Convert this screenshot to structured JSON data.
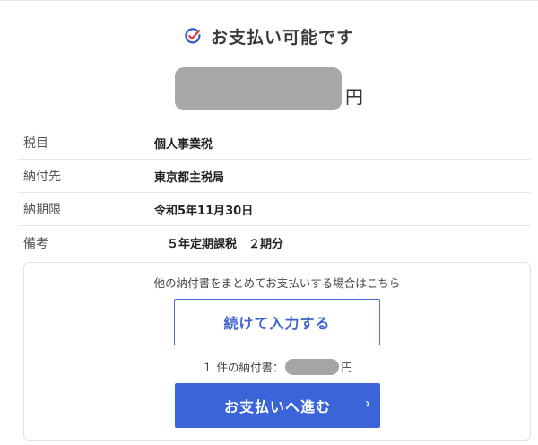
{
  "status": {
    "title": "お支払い可能です",
    "icon": "check-circle-icon",
    "icon_color": "#2f5bd0"
  },
  "amount": {
    "unit": "円"
  },
  "details": [
    {
      "label": "税目",
      "value": "個人事業税"
    },
    {
      "label": "納付先",
      "value": "東京都主税局"
    },
    {
      "label": "納期限",
      "value": "令和5年11月30日"
    },
    {
      "label": "備考",
      "value": "５年定期課税　２期分"
    }
  ],
  "panel": {
    "note": "他の納付書をまとめてお支払いする場合はこちら",
    "continue_label": "続けて入力する",
    "count_prefix": "１ 件の納付書：",
    "count_unit": "円",
    "pay_label": "お支払いへ進む",
    "pay_chevron": "›"
  },
  "colors": {
    "accent": "#3a64d8",
    "mask": "#a8a8a8"
  }
}
